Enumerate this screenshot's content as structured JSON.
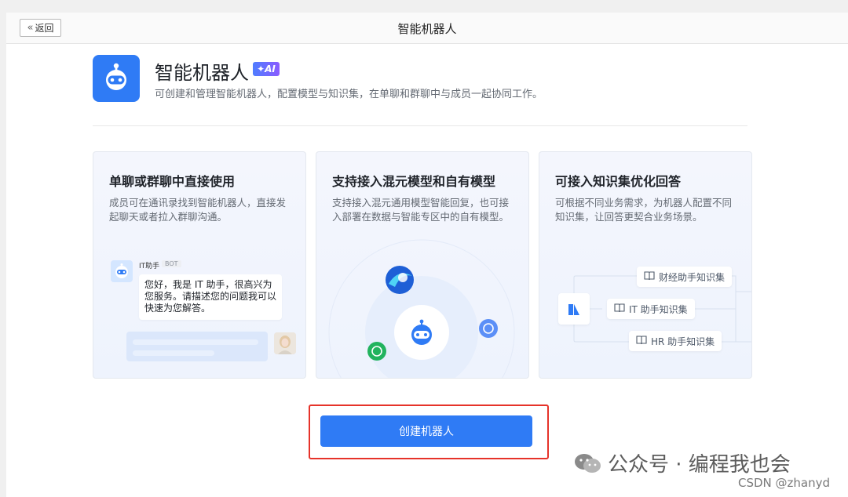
{
  "topbar": {
    "back_label": "返回",
    "title": "智能机器人"
  },
  "hero": {
    "title": "智能机器人",
    "badge": "AI",
    "description": "可创建和管理智能机器人，配置模型与知识集，在单聊和群聊中与成员一起协同工作。"
  },
  "cards": [
    {
      "title": "单聊或群聊中直接使用",
      "description": "成员可在通讯录找到智能机器人，直接发起聊天或者拉入群聊沟通。",
      "chat": {
        "bot_name": "IT助手",
        "bot_tag": "BOT",
        "bubble_text": "您好，我是 IT 助手，很高兴为您服务。请描述您的问题我可以快速为您解答。"
      }
    },
    {
      "title": "支持接入混元模型和自有模型",
      "description": "支持接入混元通用模型智能回复，也可接入部署在数据与智能专区中的自有模型。"
    },
    {
      "title": "可接入知识集优化回答",
      "description": "可根据不同业务需求，为机器人配置不同知识集，让回答更契合业务场景。",
      "knowledge_sets": [
        "财经助手知识集",
        "IT 助手知识集",
        "HR 助手知识集"
      ]
    }
  ],
  "create_button_label": "创建机器人",
  "watermark": {
    "text": "公众号 · 编程我也会",
    "csdn": "CSDN @zhanyd"
  },
  "colors": {
    "primary": "#2f7bf5",
    "highlight": "#e6332a"
  }
}
